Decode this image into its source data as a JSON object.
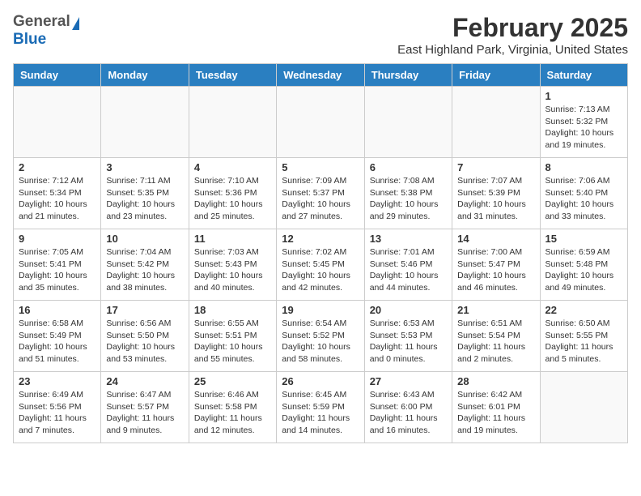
{
  "header": {
    "logo_general": "General",
    "logo_blue": "Blue",
    "title": "February 2025",
    "subtitle": "East Highland Park, Virginia, United States"
  },
  "calendar": {
    "days_of_week": [
      "Sunday",
      "Monday",
      "Tuesday",
      "Wednesday",
      "Thursday",
      "Friday",
      "Saturday"
    ],
    "weeks": [
      [
        {
          "date": "",
          "info": ""
        },
        {
          "date": "",
          "info": ""
        },
        {
          "date": "",
          "info": ""
        },
        {
          "date": "",
          "info": ""
        },
        {
          "date": "",
          "info": ""
        },
        {
          "date": "",
          "info": ""
        },
        {
          "date": "1",
          "info": "Sunrise: 7:13 AM\nSunset: 5:32 PM\nDaylight: 10 hours and 19 minutes."
        }
      ],
      [
        {
          "date": "2",
          "info": "Sunrise: 7:12 AM\nSunset: 5:34 PM\nDaylight: 10 hours and 21 minutes."
        },
        {
          "date": "3",
          "info": "Sunrise: 7:11 AM\nSunset: 5:35 PM\nDaylight: 10 hours and 23 minutes."
        },
        {
          "date": "4",
          "info": "Sunrise: 7:10 AM\nSunset: 5:36 PM\nDaylight: 10 hours and 25 minutes."
        },
        {
          "date": "5",
          "info": "Sunrise: 7:09 AM\nSunset: 5:37 PM\nDaylight: 10 hours and 27 minutes."
        },
        {
          "date": "6",
          "info": "Sunrise: 7:08 AM\nSunset: 5:38 PM\nDaylight: 10 hours and 29 minutes."
        },
        {
          "date": "7",
          "info": "Sunrise: 7:07 AM\nSunset: 5:39 PM\nDaylight: 10 hours and 31 minutes."
        },
        {
          "date": "8",
          "info": "Sunrise: 7:06 AM\nSunset: 5:40 PM\nDaylight: 10 hours and 33 minutes."
        }
      ],
      [
        {
          "date": "9",
          "info": "Sunrise: 7:05 AM\nSunset: 5:41 PM\nDaylight: 10 hours and 35 minutes."
        },
        {
          "date": "10",
          "info": "Sunrise: 7:04 AM\nSunset: 5:42 PM\nDaylight: 10 hours and 38 minutes."
        },
        {
          "date": "11",
          "info": "Sunrise: 7:03 AM\nSunset: 5:43 PM\nDaylight: 10 hours and 40 minutes."
        },
        {
          "date": "12",
          "info": "Sunrise: 7:02 AM\nSunset: 5:45 PM\nDaylight: 10 hours and 42 minutes."
        },
        {
          "date": "13",
          "info": "Sunrise: 7:01 AM\nSunset: 5:46 PM\nDaylight: 10 hours and 44 minutes."
        },
        {
          "date": "14",
          "info": "Sunrise: 7:00 AM\nSunset: 5:47 PM\nDaylight: 10 hours and 46 minutes."
        },
        {
          "date": "15",
          "info": "Sunrise: 6:59 AM\nSunset: 5:48 PM\nDaylight: 10 hours and 49 minutes."
        }
      ],
      [
        {
          "date": "16",
          "info": "Sunrise: 6:58 AM\nSunset: 5:49 PM\nDaylight: 10 hours and 51 minutes."
        },
        {
          "date": "17",
          "info": "Sunrise: 6:56 AM\nSunset: 5:50 PM\nDaylight: 10 hours and 53 minutes."
        },
        {
          "date": "18",
          "info": "Sunrise: 6:55 AM\nSunset: 5:51 PM\nDaylight: 10 hours and 55 minutes."
        },
        {
          "date": "19",
          "info": "Sunrise: 6:54 AM\nSunset: 5:52 PM\nDaylight: 10 hours and 58 minutes."
        },
        {
          "date": "20",
          "info": "Sunrise: 6:53 AM\nSunset: 5:53 PM\nDaylight: 11 hours and 0 minutes."
        },
        {
          "date": "21",
          "info": "Sunrise: 6:51 AM\nSunset: 5:54 PM\nDaylight: 11 hours and 2 minutes."
        },
        {
          "date": "22",
          "info": "Sunrise: 6:50 AM\nSunset: 5:55 PM\nDaylight: 11 hours and 5 minutes."
        }
      ],
      [
        {
          "date": "23",
          "info": "Sunrise: 6:49 AM\nSunset: 5:56 PM\nDaylight: 11 hours and 7 minutes."
        },
        {
          "date": "24",
          "info": "Sunrise: 6:47 AM\nSunset: 5:57 PM\nDaylight: 11 hours and 9 minutes."
        },
        {
          "date": "25",
          "info": "Sunrise: 6:46 AM\nSunset: 5:58 PM\nDaylight: 11 hours and 12 minutes."
        },
        {
          "date": "26",
          "info": "Sunrise: 6:45 AM\nSunset: 5:59 PM\nDaylight: 11 hours and 14 minutes."
        },
        {
          "date": "27",
          "info": "Sunrise: 6:43 AM\nSunset: 6:00 PM\nDaylight: 11 hours and 16 minutes."
        },
        {
          "date": "28",
          "info": "Sunrise: 6:42 AM\nSunset: 6:01 PM\nDaylight: 11 hours and 19 minutes."
        },
        {
          "date": "",
          "info": ""
        }
      ]
    ]
  }
}
